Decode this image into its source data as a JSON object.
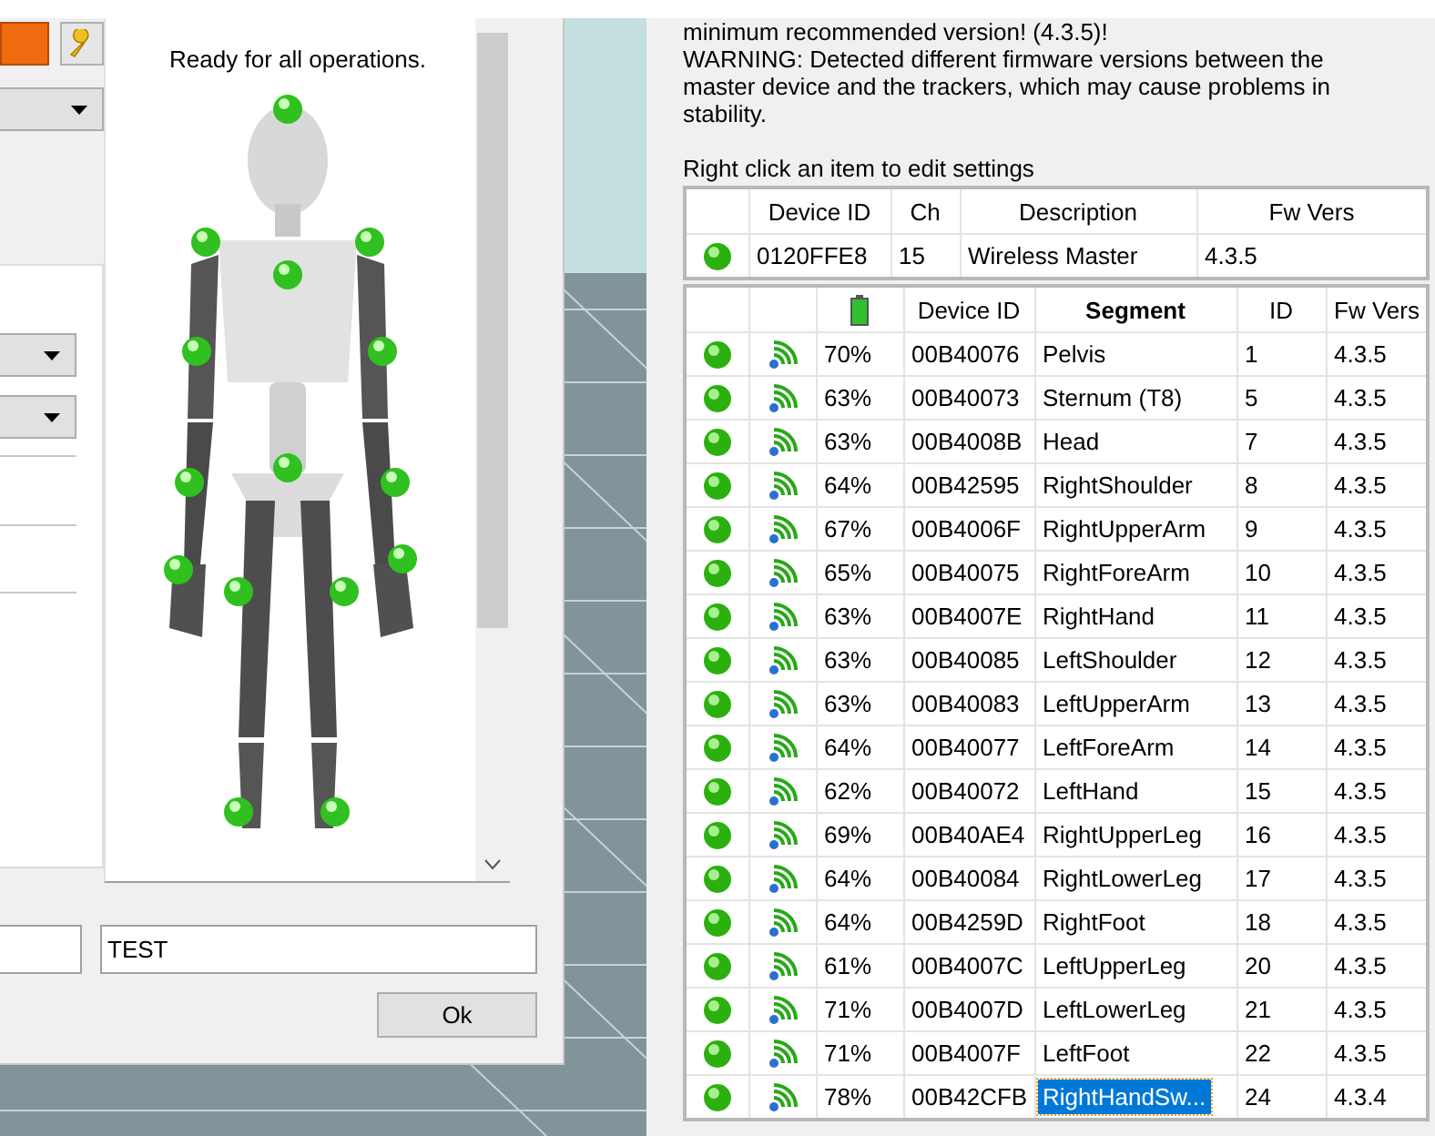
{
  "dialog": {
    "status_text": "Ready for all operations.",
    "name_field": {
      "value": "TEST"
    },
    "ok_button": "Ok"
  },
  "panel": {
    "warning_lines": [
      "minimum recommended version! (4.3.5)!",
      "WARNING: Detected different firmware versions between the master device and the trackers, which may cause problems in stability."
    ],
    "hint": "Right click an item to edit settings",
    "master": {
      "columns": [
        "Device ID",
        "Ch",
        "Description",
        "Fw Vers"
      ],
      "row": {
        "color": "#2cb010",
        "device_id": "0120FFE8",
        "ch": "15",
        "description": "Wireless Master",
        "fw": "4.3.5"
      }
    },
    "trackers": {
      "columns": [
        "Device ID",
        "Segment",
        "ID",
        "Fw Vers"
      ],
      "rows": [
        {
          "color": "#2cb010",
          "battery": "70%",
          "device_id": "00B40076",
          "segment": "Pelvis",
          "id": "1",
          "fw": "4.3.5",
          "selected": false
        },
        {
          "color": "#2cb010",
          "battery": "63%",
          "device_id": "00B40073",
          "segment": "Sternum (T8)",
          "id": "5",
          "fw": "4.3.5",
          "selected": false
        },
        {
          "color": "#2cb010",
          "battery": "63%",
          "device_id": "00B4008B",
          "segment": "Head",
          "id": "7",
          "fw": "4.3.5",
          "selected": false
        },
        {
          "color": "#2cb010",
          "battery": "64%",
          "device_id": "00B42595",
          "segment": "RightShoulder",
          "id": "8",
          "fw": "4.3.5",
          "selected": false
        },
        {
          "color": "#2cb010",
          "battery": "67%",
          "device_id": "00B4006F",
          "segment": "RightUpperArm",
          "id": "9",
          "fw": "4.3.5",
          "selected": false
        },
        {
          "color": "#2cb010",
          "battery": "65%",
          "device_id": "00B40075",
          "segment": "RightForeArm",
          "id": "10",
          "fw": "4.3.5",
          "selected": false
        },
        {
          "color": "#2cb010",
          "battery": "63%",
          "device_id": "00B4007E",
          "segment": "RightHand",
          "id": "11",
          "fw": "4.3.5",
          "selected": false
        },
        {
          "color": "#2cb010",
          "battery": "63%",
          "device_id": "00B40085",
          "segment": "LeftShoulder",
          "id": "12",
          "fw": "4.3.5",
          "selected": false
        },
        {
          "color": "#2cb010",
          "battery": "63%",
          "device_id": "00B40083",
          "segment": "LeftUpperArm",
          "id": "13",
          "fw": "4.3.5",
          "selected": false
        },
        {
          "color": "#2cb010",
          "battery": "64%",
          "device_id": "00B40077",
          "segment": "LeftForeArm",
          "id": "14",
          "fw": "4.3.5",
          "selected": false
        },
        {
          "color": "#2cb010",
          "battery": "62%",
          "device_id": "00B40072",
          "segment": "LeftHand",
          "id": "15",
          "fw": "4.3.5",
          "selected": false
        },
        {
          "color": "#2cb010",
          "battery": "69%",
          "device_id": "00B40AE4",
          "segment": "RightUpperLeg",
          "id": "16",
          "fw": "4.3.5",
          "selected": false
        },
        {
          "color": "#2cb010",
          "battery": "64%",
          "device_id": "00B40084",
          "segment": "RightLowerLeg",
          "id": "17",
          "fw": "4.3.5",
          "selected": false
        },
        {
          "color": "#2cb010",
          "battery": "64%",
          "device_id": "00B4259D",
          "segment": "RightFoot",
          "id": "18",
          "fw": "4.3.5",
          "selected": false
        },
        {
          "color": "#2cb010",
          "battery": "61%",
          "device_id": "00B4007C",
          "segment": "LeftUpperLeg",
          "id": "20",
          "fw": "4.3.5",
          "selected": false
        },
        {
          "color": "#2cb010",
          "battery": "71%",
          "device_id": "00B4007D",
          "segment": "LeftLowerLeg",
          "id": "21",
          "fw": "4.3.5",
          "selected": false
        },
        {
          "color": "#2cb010",
          "battery": "71%",
          "device_id": "00B4007F",
          "segment": "LeftFoot",
          "id": "22",
          "fw": "4.3.5",
          "selected": false
        },
        {
          "color": "#2cb010",
          "battery": "78%",
          "device_id": "00B42CFB",
          "segment": "RightHandSw...",
          "id": "24",
          "fw": "4.3.4",
          "selected": true
        }
      ]
    }
  }
}
